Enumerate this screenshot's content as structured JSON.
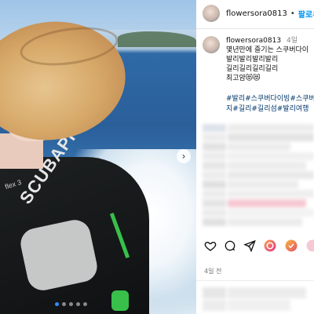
{
  "post": {
    "username": "flowersora0813",
    "separator": "•",
    "follow_label": "팔로우",
    "caption": {
      "time": "4일",
      "lines": [
        "몇년만에 즐기는 스쿠버다이",
        "발리발리발리발리",
        "길리길리길리길리",
        "최고얌😻😻"
      ],
      "hashtags": [
        "#발리#스쿠버다이빙#스쿠버",
        "지#길리#길리섬#발리여행"
      ]
    },
    "posted_ago": "4일 전",
    "image": {
      "suit_brand": "SCUBAPRO",
      "suit_small_text": "flex 3",
      "carousel_dots": 5,
      "active_dot": 0
    }
  },
  "icons": {
    "like": "heart-icon",
    "comment": "comment-icon",
    "share": "send-icon",
    "next": "chevron-right-icon"
  },
  "colors": {
    "follow": "#0095f6",
    "hashtag": "#00376b",
    "carousel_active": "#2d8cff"
  }
}
